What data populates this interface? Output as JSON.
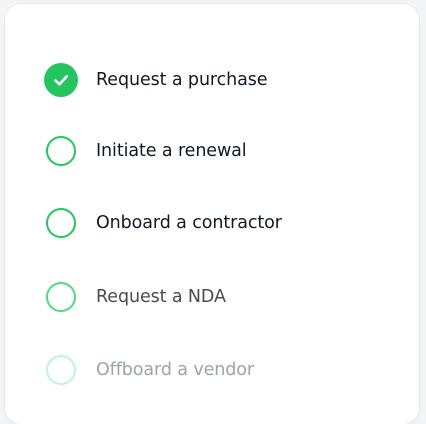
{
  "checklist": {
    "items": [
      {
        "label": "Request a purchase",
        "checked": true
      },
      {
        "label": "Initiate a renewal",
        "checked": false
      },
      {
        "label": "Onboard a contractor",
        "checked": false
      },
      {
        "label": "Request a NDA",
        "checked": false
      },
      {
        "label": "Offboard a vendor",
        "checked": false
      }
    ]
  },
  "colors": {
    "accent": "#22c55e",
    "text_primary": "#111827",
    "text_secondary": "#4b4b4b",
    "text_muted": "#9ca3af"
  },
  "icons": {
    "checked": "check-icon"
  }
}
